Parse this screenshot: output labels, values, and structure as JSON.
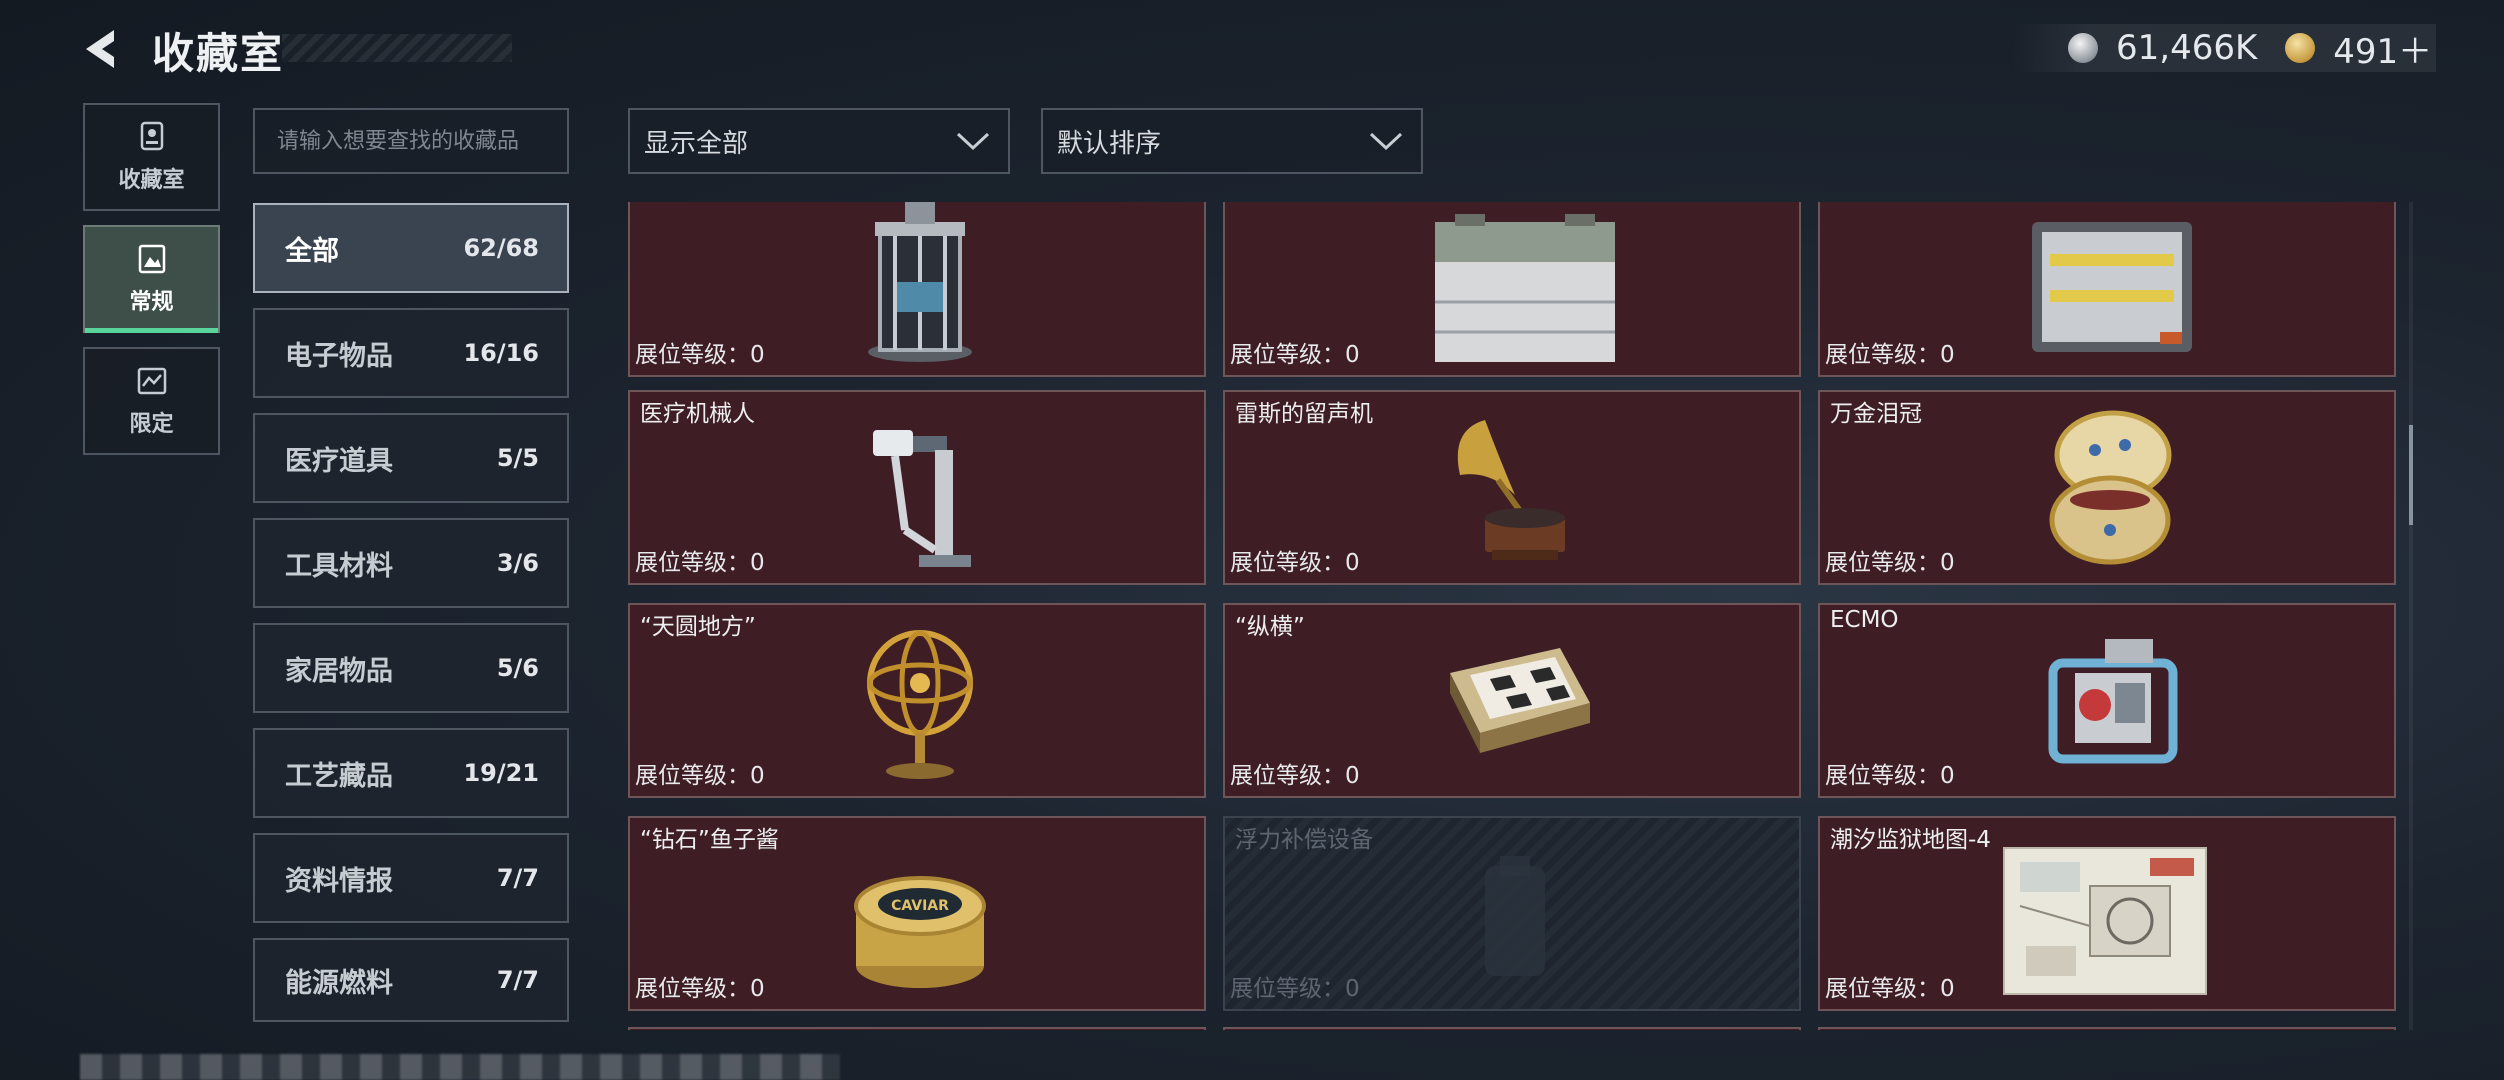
{
  "header": {
    "title": "收藏室",
    "back_icon": "back-arrow-icon"
  },
  "currency": [
    {
      "icon": "silver-coin-icon",
      "value": "61,466K",
      "color": "#b9c0c7"
    },
    {
      "icon": "gold-coin-icon",
      "value": "491＋",
      "color": "#c79a3e"
    }
  ],
  "left_nav": [
    {
      "label": "收藏室",
      "icon": "trophy-case-icon",
      "active": false
    },
    {
      "label": "常规",
      "icon": "gallery-icon",
      "active": true
    },
    {
      "label": "限定",
      "icon": "limited-badge-icon",
      "active": false
    }
  ],
  "search": {
    "placeholder": "请输入想要查找的收藏品"
  },
  "filters": {
    "display": {
      "label": "显示全部"
    },
    "sort": {
      "label": "默认排序"
    }
  },
  "categories": [
    {
      "name": "全部",
      "count": "62/68",
      "active": true
    },
    {
      "name": "电子物品",
      "count": "16/16"
    },
    {
      "name": "医疗道具",
      "count": "5/5"
    },
    {
      "name": "工具材料",
      "count": "3/6"
    },
    {
      "name": "家居物品",
      "count": "5/6"
    },
    {
      "name": "工艺藏品",
      "count": "19/21"
    },
    {
      "name": "资料情报",
      "count": "7/7"
    },
    {
      "name": "能源燃料",
      "count": "7/7"
    }
  ],
  "level_label": "展位等级：0",
  "items": [
    {
      "name": "",
      "level": "展位等级：0",
      "icon": "reactor-core-icon",
      "locked": false
    },
    {
      "name": "",
      "level": "展位等级：0",
      "icon": "battery-unit-icon",
      "locked": false
    },
    {
      "name": "",
      "level": "展位等级：0",
      "icon": "battery-pack-icon",
      "locked": false
    },
    {
      "name": "医疗机械人",
      "level": "展位等级：0",
      "icon": "medical-robot-icon",
      "locked": false
    },
    {
      "name": "雷斯的留声机",
      "level": "展位等级：0",
      "icon": "gramophone-icon",
      "locked": false
    },
    {
      "name": "万金泪冠",
      "level": "展位等级：0",
      "icon": "jeweled-egg-icon",
      "locked": false
    },
    {
      "name": "“天圆地方”",
      "level": "展位等级：0",
      "icon": "armillary-sphere-icon",
      "locked": false
    },
    {
      "name": "“纵横”",
      "level": "展位等级：0",
      "icon": "chessboard-icon",
      "locked": false
    },
    {
      "name": "ECMO",
      "level": "展位等级：0",
      "icon": "ecmo-machine-icon",
      "locked": false
    },
    {
      "name": "“钻石”鱼子酱",
      "level": "展位等级：0",
      "icon": "caviar-tin-icon",
      "locked": false
    },
    {
      "name": "浮力补偿设备",
      "level": "展位等级：0",
      "icon": "bcd-vest-icon",
      "locked": true
    },
    {
      "name": "潮汐监狱地图-4",
      "level": "展位等级：0",
      "icon": "map-sheet-icon",
      "locked": false
    }
  ],
  "caviar_text": "CAVIAR"
}
